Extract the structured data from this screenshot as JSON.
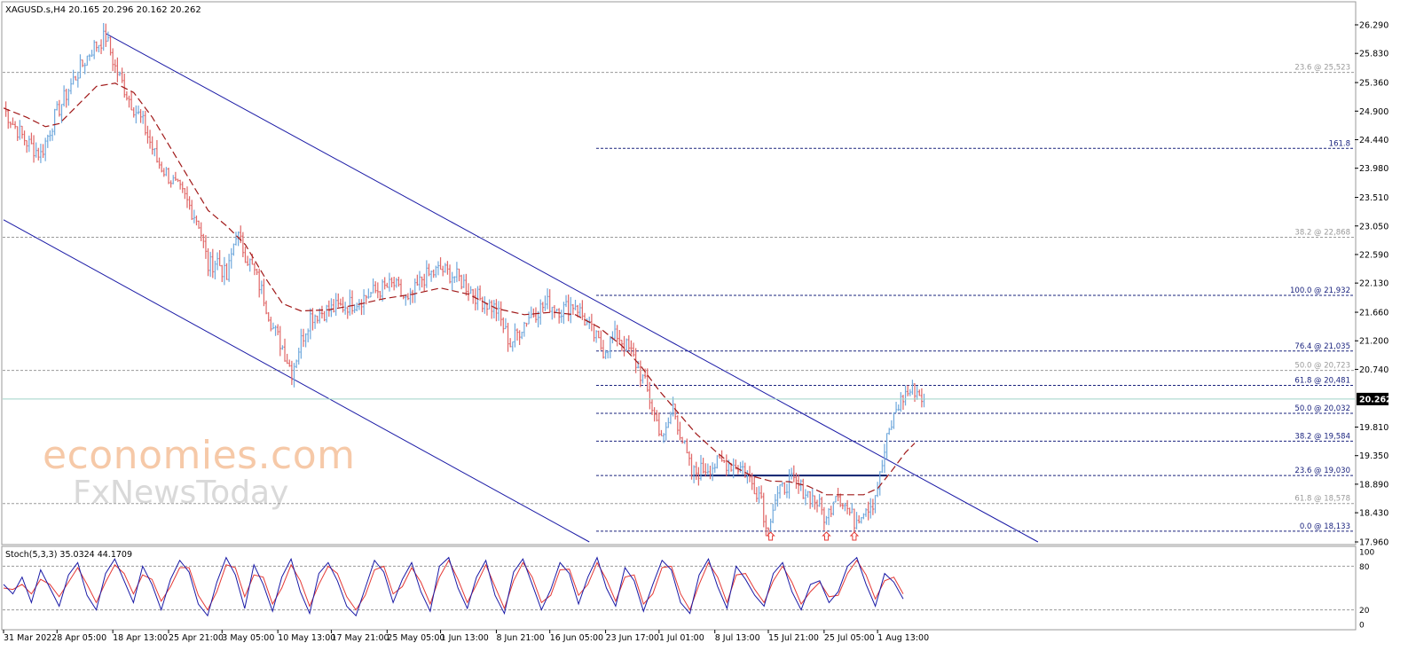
{
  "chart_data": {
    "type": "candlestick",
    "symbol_header": "XAGUSD.s,H4  20.165 20.296 20.162 20.262",
    "current_price": "20.262",
    "y_ticks": [
      "26.290",
      "25.830",
      "25.360",
      "24.900",
      "24.440",
      "23.980",
      "23.510",
      "23.050",
      "22.590",
      "22.130",
      "21.660",
      "21.200",
      "20.740",
      "20.262",
      "19.810",
      "19.350",
      "18.890",
      "18.430",
      "17.960"
    ],
    "ylim": [
      17.96,
      26.29
    ],
    "x_ticks": [
      "31 Mar 2022",
      "8 Apr 05:00",
      "18 Apr 13:00",
      "25 Apr 21:00",
      "3 May 05:00",
      "10 May 13:00",
      "17 May 21:00",
      "25 May 05:00",
      "1 Jun 13:00",
      "8 Jun 21:00",
      "16 Jun 05:00",
      "23 Jun 17:00",
      "1 Jul 01:00",
      "8 Jul 13:00",
      "15 Jul 21:00",
      "25 Jul 05:00",
      "1 Aug 13:00"
    ],
    "x_tick_index": [
      0,
      23,
      47,
      71,
      94,
      118,
      141,
      165,
      188,
      212,
      235,
      259,
      282,
      306,
      329,
      353,
      376
    ],
    "price_path": [
      [
        0,
        24.95
      ],
      [
        4,
        24.7
      ],
      [
        10,
        24.4
      ],
      [
        16,
        24.2
      ],
      [
        22,
        24.8
      ],
      [
        30,
        25.4
      ],
      [
        38,
        25.9
      ],
      [
        44,
        26.1
      ],
      [
        48,
        25.6
      ],
      [
        54,
        25.1
      ],
      [
        60,
        24.7
      ],
      [
        66,
        24.1
      ],
      [
        72,
        23.8
      ],
      [
        78,
        23.5
      ],
      [
        84,
        23.1
      ],
      [
        88,
        22.4
      ],
      [
        92,
        22.5
      ],
      [
        96,
        22.2
      ],
      [
        100,
        22.95
      ],
      [
        104,
        22.6
      ],
      [
        108,
        22.3
      ],
      [
        112,
        21.9
      ],
      [
        116,
        21.4
      ],
      [
        120,
        21.1
      ],
      [
        124,
        20.7
      ],
      [
        128,
        21.2
      ],
      [
        132,
        21.6
      ],
      [
        140,
        21.7
      ],
      [
        150,
        21.8
      ],
      [
        160,
        22.0
      ],
      [
        168,
        22.1
      ],
      [
        174,
        21.8
      ],
      [
        180,
        22.2
      ],
      [
        188,
        22.35
      ],
      [
        196,
        22.2
      ],
      [
        204,
        21.9
      ],
      [
        212,
        21.7
      ],
      [
        218,
        21.15
      ],
      [
        226,
        21.6
      ],
      [
        234,
        21.8
      ],
      [
        240,
        21.7
      ],
      [
        246,
        21.8
      ],
      [
        252,
        21.4
      ],
      [
        258,
        21.05
      ],
      [
        264,
        21.3
      ],
      [
        270,
        21.0
      ],
      [
        276,
        20.5
      ],
      [
        280,
        20.0
      ],
      [
        284,
        19.6
      ],
      [
        288,
        20.15
      ],
      [
        292,
        19.6
      ],
      [
        296,
        19.05
      ],
      [
        302,
        19.15
      ],
      [
        310,
        19.25
      ],
      [
        318,
        19.15
      ],
      [
        322,
        18.9
      ],
      [
        326,
        18.7
      ],
      [
        328,
        18.15
      ],
      [
        332,
        18.65
      ],
      [
        338,
        18.95
      ],
      [
        344,
        18.8
      ],
      [
        350,
        18.6
      ],
      [
        354,
        18.3
      ],
      [
        358,
        18.8
      ],
      [
        362,
        18.55
      ],
      [
        366,
        18.3
      ],
      [
        370,
        18.5
      ],
      [
        374,
        18.6
      ],
      [
        377,
        19.0
      ],
      [
        380,
        19.6
      ],
      [
        384,
        20.1
      ],
      [
        388,
        20.35
      ],
      [
        392,
        20.42
      ],
      [
        396,
        20.26
      ]
    ],
    "moving_average_path": [
      [
        0,
        24.95
      ],
      [
        10,
        24.8
      ],
      [
        18,
        24.65
      ],
      [
        24,
        24.7
      ],
      [
        32,
        25.0
      ],
      [
        40,
        25.3
      ],
      [
        48,
        25.35
      ],
      [
        56,
        25.2
      ],
      [
        64,
        24.8
      ],
      [
        72,
        24.3
      ],
      [
        80,
        23.8
      ],
      [
        88,
        23.3
      ],
      [
        96,
        23.05
      ],
      [
        104,
        22.75
      ],
      [
        112,
        22.25
      ],
      [
        120,
        21.8
      ],
      [
        128,
        21.68
      ],
      [
        140,
        21.7
      ],
      [
        152,
        21.78
      ],
      [
        164,
        21.88
      ],
      [
        176,
        21.95
      ],
      [
        188,
        22.05
      ],
      [
        200,
        21.95
      ],
      [
        212,
        21.72
      ],
      [
        224,
        21.62
      ],
      [
        236,
        21.66
      ],
      [
        246,
        21.62
      ],
      [
        256,
        21.42
      ],
      [
        266,
        21.12
      ],
      [
        274,
        20.8
      ],
      [
        282,
        20.4
      ],
      [
        290,
        20.05
      ],
      [
        298,
        19.7
      ],
      [
        306,
        19.43
      ],
      [
        314,
        19.18
      ],
      [
        322,
        19.02
      ],
      [
        330,
        18.94
      ],
      [
        338,
        18.93
      ],
      [
        346,
        18.86
      ],
      [
        354,
        18.72
      ],
      [
        362,
        18.72
      ],
      [
        370,
        18.72
      ],
      [
        376,
        18.82
      ],
      [
        382,
        19.1
      ],
      [
        388,
        19.4
      ],
      [
        392,
        19.55
      ]
    ],
    "fib_levels_right": [
      {
        "label": "161.8",
        "value": 24.3
      },
      {
        "label": "100.0 @ 21,932",
        "value": 21.932
      },
      {
        "label": "76.4 @ 21,035",
        "value": 21.035
      },
      {
        "label": "61.8 @ 20,481",
        "value": 20.481
      },
      {
        "label": "50.0 @ 20,032",
        "value": 20.032
      },
      {
        "label": "38.2 @ 19,584",
        "value": 19.584
      },
      {
        "label": "23.6 @ 19,030",
        "value": 19.03
      },
      {
        "label": "0.0 @ 18,133",
        "value": 18.133
      }
    ],
    "fib_levels_full": [
      {
        "label": "23.6 @ 25,523",
        "value": 25.523
      },
      {
        "label": "38.2 @ 22,868",
        "value": 22.868
      },
      {
        "label": "50.0 @ 20,723",
        "value": 20.723
      },
      {
        "label": "61.8 @ 18,578",
        "value": 18.578
      }
    ],
    "horizontal_support": {
      "value": 19.03,
      "from_index": 296,
      "to_index": 380
    },
    "channel_upper": {
      "p1": [
        44,
        26.15
      ],
      "p2": [
        392,
        19.05
      ]
    },
    "channel_upper_ext": {
      "to_index": 445,
      "to_value": 17.96
    },
    "channel_lower": {
      "p1": [
        0,
        23.15
      ],
      "p2": [
        252,
        17.96
      ]
    },
    "bottom_markers_index": [
      330,
      354,
      366
    ],
    "stochastic": {
      "label": "Stoch(5,3,3) 35.0324 44.1709",
      "levels": [
        "100",
        "80",
        "20",
        "0"
      ],
      "k_values": [
        55,
        42,
        65,
        30,
        75,
        50,
        25,
        68,
        85,
        40,
        20,
        70,
        90,
        60,
        30,
        80,
        55,
        20,
        62,
        88,
        72,
        28,
        12,
        58,
        92,
        68,
        22,
        82,
        55,
        18,
        65,
        90,
        45,
        15,
        70,
        85,
        60,
        25,
        12,
        50,
        88,
        72,
        30,
        62,
        85,
        45,
        18,
        80,
        92,
        50,
        22,
        65,
        88,
        40,
        15,
        72,
        90,
        55,
        20,
        48,
        85,
        70,
        28,
        65,
        92,
        50,
        25,
        78,
        60,
        18,
        55,
        88,
        75,
        30,
        15,
        68,
        90,
        52,
        22,
        80,
        62,
        40,
        25,
        70,
        85,
        45,
        20,
        55,
        60,
        30,
        45,
        80,
        92,
        55,
        25,
        70,
        58,
        35
      ],
      "d_values": [
        50,
        48,
        55,
        42,
        62,
        55,
        38,
        58,
        78,
        55,
        30,
        58,
        82,
        70,
        42,
        68,
        62,
        32,
        52,
        78,
        78,
        40,
        20,
        45,
        82,
        78,
        38,
        68,
        65,
        28,
        50,
        82,
        60,
        25,
        55,
        80,
        70,
        38,
        20,
        40,
        75,
        80,
        42,
        52,
        78,
        58,
        28,
        65,
        88,
        62,
        30,
        55,
        82,
        52,
        22,
        60,
        85,
        65,
        30,
        40,
        75,
        76,
        40,
        55,
        85,
        62,
        32,
        65,
        68,
        28,
        42,
        78,
        80,
        42,
        20,
        55,
        85,
        65,
        30,
        68,
        70,
        48,
        30,
        60,
        80,
        58,
        28,
        45,
        58,
        38,
        40,
        70,
        88,
        68,
        35,
        60,
        65,
        42
      ]
    },
    "watermark": [
      "economies.com",
      "FxNewsToday"
    ]
  }
}
